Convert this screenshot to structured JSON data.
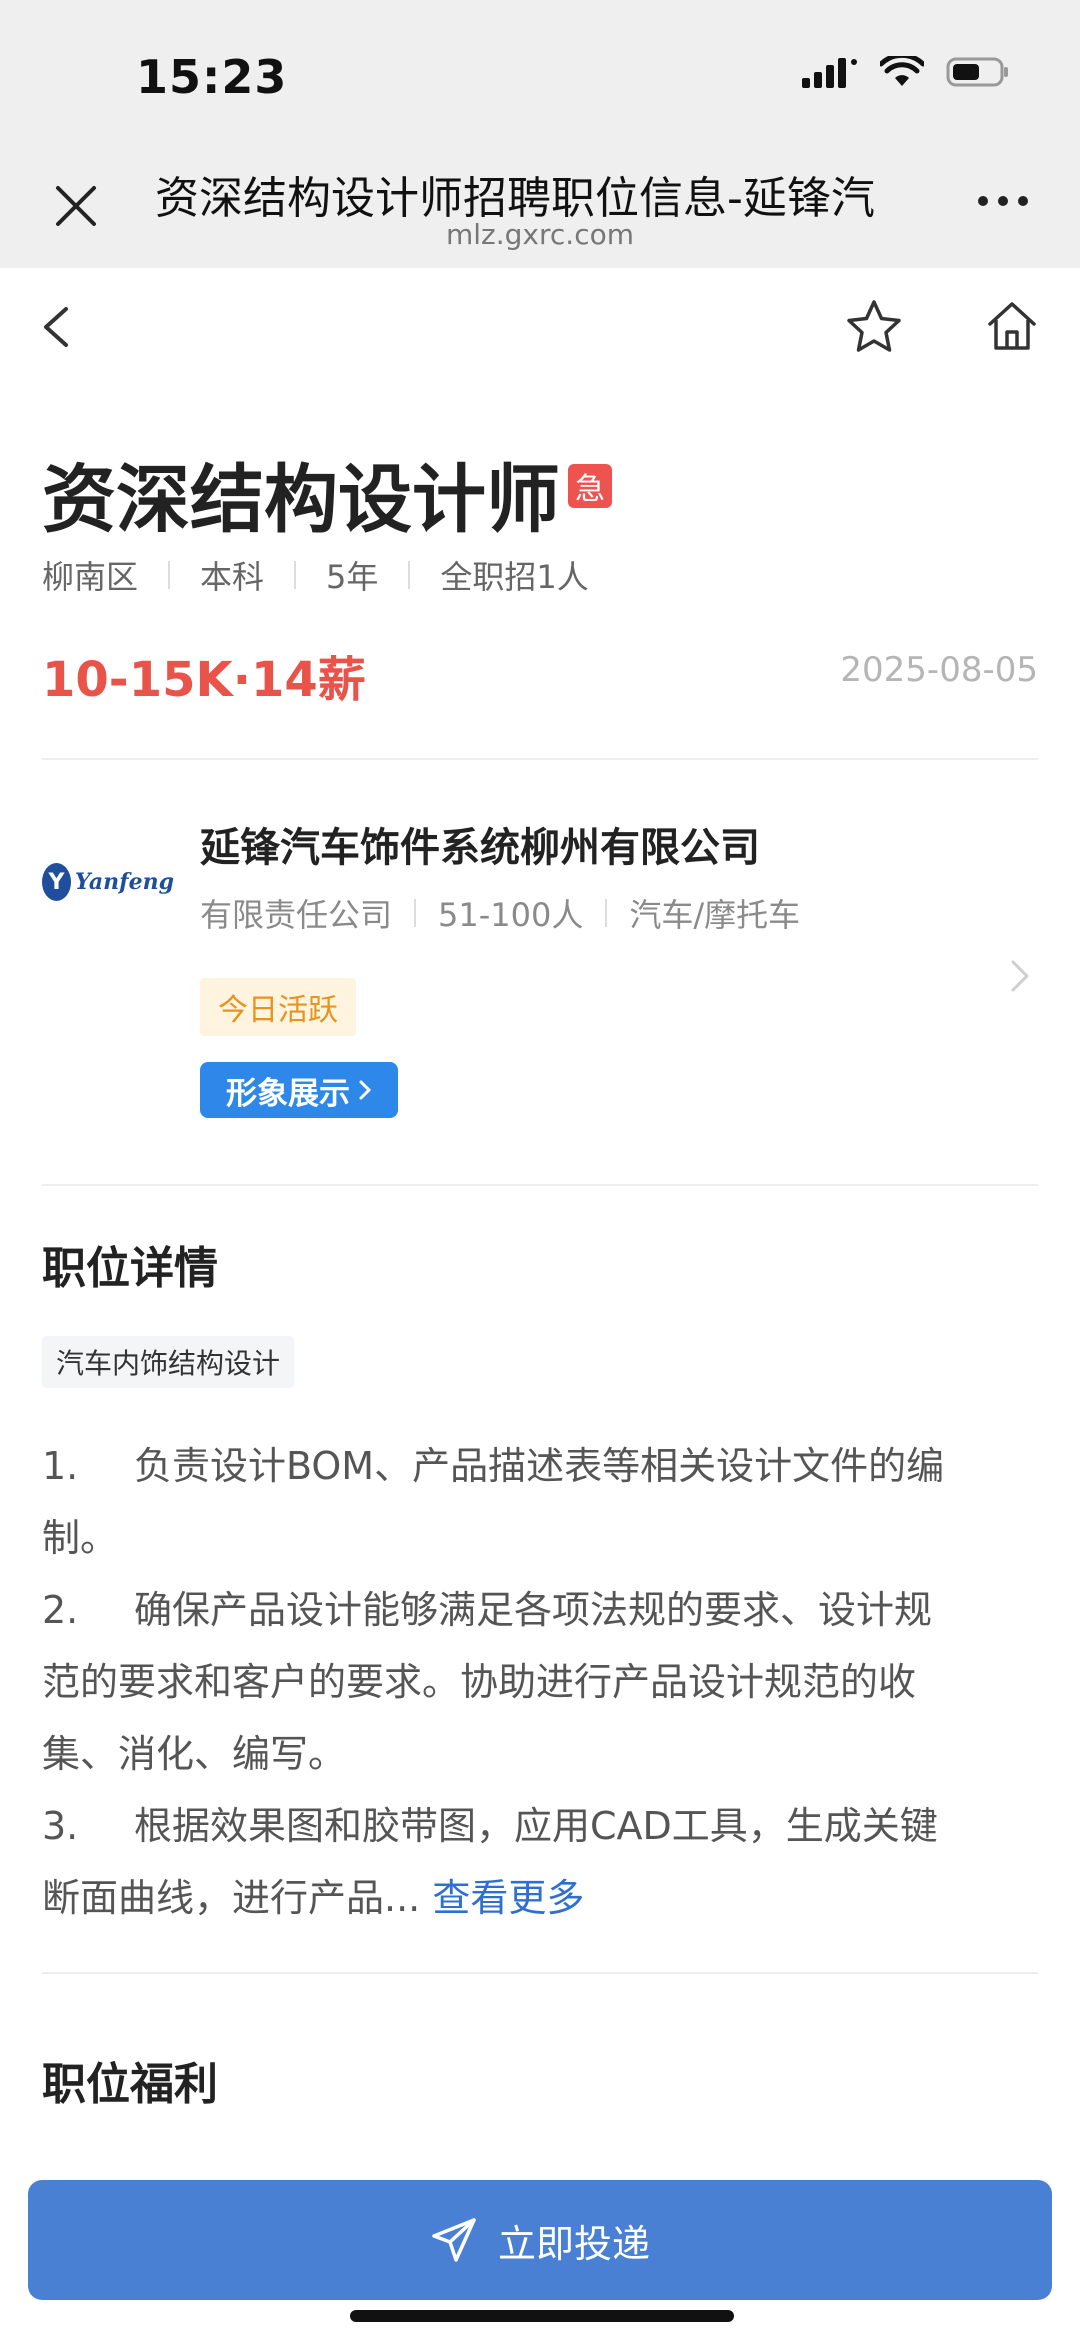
{
  "status_bar": {
    "time": "15:23"
  },
  "browser": {
    "title": "资深结构设计师招聘职位信息-延锋汽",
    "url": "mlz.gxrc.com"
  },
  "job": {
    "title": "资深结构设计师",
    "urgent_badge": "急",
    "meta": [
      "柳南区",
      "本科",
      "5年",
      "全职招1人"
    ],
    "salary": "10-15K·14薪",
    "date": "2025-08-05"
  },
  "company": {
    "logo_text": "Yanfeng",
    "name": "延锋汽车饰件系统柳州有限公司",
    "meta": [
      "有限责任公司",
      "51-100人",
      "汽车/摩托车"
    ],
    "active_tag": "今日活跃",
    "image_button": "形象展示"
  },
  "details": {
    "section_title": "职位详情",
    "tag": "汽车内饰结构设计",
    "lines": [
      {
        "num": "1.",
        "text": "负责设计BOM、产品描述表等相关设计文件的编"
      },
      {
        "num": "",
        "text": "制。"
      },
      {
        "num": "2.",
        "text": "确保产品设计能够满足各项法规的要求、设计规"
      },
      {
        "num": "",
        "text": "范的要求和客户的要求。协助进行产品设计规范的收"
      },
      {
        "num": "",
        "text": "集、消化、编写。"
      },
      {
        "num": "3.",
        "text": "根据效果图和胶带图，应用CAD工具，生成关键"
      }
    ],
    "last_line": "断面曲线，进行产品...",
    "more_link": "查看更多"
  },
  "benefits": {
    "section_title": "职位福利"
  },
  "apply_button": "立即投递",
  "colors": {
    "salary": "#e8534a",
    "urgent": "#ef5350",
    "primary_button": "#4a80d4",
    "link": "#2e6fd0",
    "active_tag_bg": "#fff4e0",
    "active_tag_text": "#e7931e"
  }
}
